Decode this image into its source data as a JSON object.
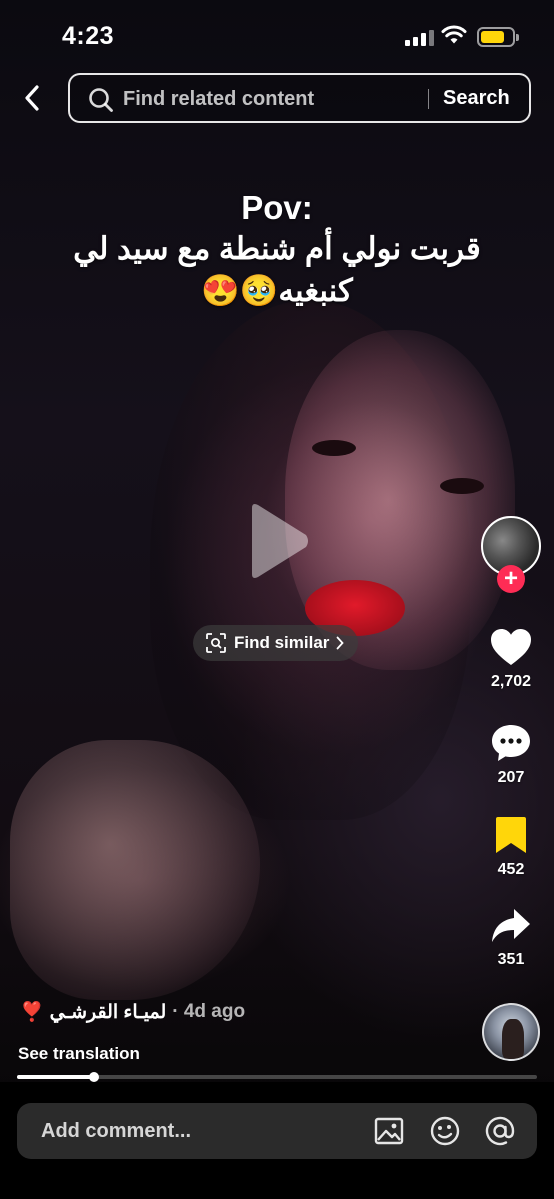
{
  "status_bar": {
    "time": "4:23"
  },
  "header": {
    "search_placeholder": "Find related content",
    "search_button": "Search"
  },
  "caption": {
    "title": "Pov:",
    "line1": "قربت نولي أم شنطة مع سيد لي",
    "line2": "كنبغيه🥹😍"
  },
  "find_similar": {
    "label": "Find similar"
  },
  "actions": {
    "likes": "2,702",
    "comments": "207",
    "saves": "452",
    "shares": "351"
  },
  "author": {
    "name": "لميـاء القرشـي",
    "heart_emoji": "❣️",
    "time": "· 4d ago"
  },
  "see_translation": "See translation",
  "progress": {
    "fraction": 0.148
  },
  "comment_bar": {
    "placeholder": "Add comment..."
  },
  "colors": {
    "follow_accent": "#fe2c55",
    "save_active": "#ffd60a",
    "battery": "#ffd60a"
  }
}
